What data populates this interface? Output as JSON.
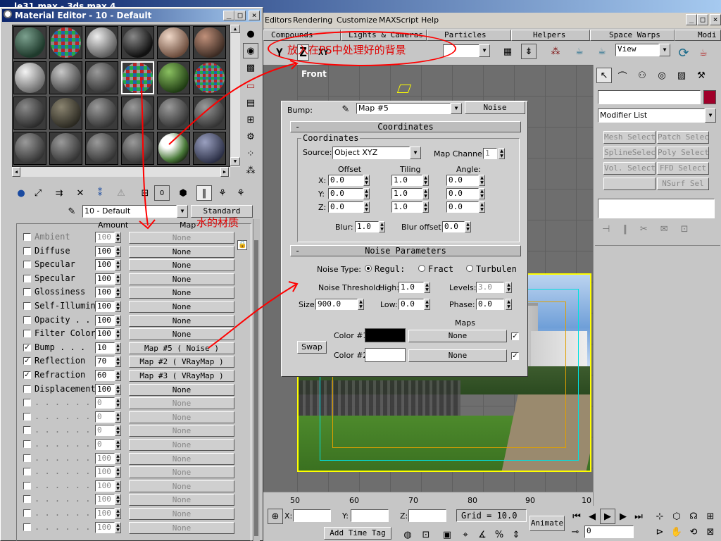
{
  "window_title": "le31.max - 3ds max 4",
  "menu": {
    "items": [
      "Editors",
      "Rendering",
      "Customize",
      "MAXScript",
      "Help"
    ],
    "window_buttons": [
      "_",
      "□",
      "×"
    ]
  },
  "command_tabs": [
    "Compounds",
    "Lights & Cameras",
    "Particles",
    "Helpers",
    "Space Warps",
    "Modi"
  ],
  "toolbar": {
    "view_dropdown": "View",
    "axis_letters": [
      "Y",
      "Z",
      "XY"
    ]
  },
  "annotation_top": "放入在PS中处理好的背景",
  "annotation_water": "水的材质",
  "viewport": {
    "label": "Front"
  },
  "timeline": {
    "ticks": [
      "50",
      "60",
      "70",
      "80",
      "90",
      "10"
    ]
  },
  "status": {
    "x_label": "X:",
    "y_label": "Y:",
    "z_label": "Z:",
    "grid": "Grid = 10.0",
    "animate": "Animate",
    "add_time_tag": "Add Time Tag",
    "frame": "0"
  },
  "command_panel": {
    "modifier_list": "Modifier List",
    "buttons": [
      "Mesh Select",
      "Patch Select",
      "SplineSelect",
      "Poly Select",
      "Vol. Select",
      "FFD Select",
      "",
      "NSurf Sel"
    ],
    "swatch_color": "#a0002a"
  },
  "material_editor": {
    "title": "Material Editor - 10 - Default",
    "material_name": "10 - Default",
    "type_button": "Standard",
    "col_amount": "Amount",
    "col_map": "Map",
    "rows": [
      {
        "label": "Ambient",
        "checked": false,
        "amount": "100",
        "map": "None",
        "dim": true
      },
      {
        "label": "Diffuse",
        "checked": false,
        "amount": "100",
        "map": "None",
        "dim": false
      },
      {
        "label": "Specular",
        "checked": false,
        "amount": "100",
        "map": "None",
        "dim": false
      },
      {
        "label": "Specular",
        "checked": false,
        "amount": "100",
        "map": "None",
        "dim": false
      },
      {
        "label": "Glossiness",
        "checked": false,
        "amount": "100",
        "map": "None",
        "dim": false
      },
      {
        "label": "Self-Illumin",
        "checked": false,
        "amount": "100",
        "map": "None",
        "dim": false
      },
      {
        "label": "Opacity . .",
        "checked": false,
        "amount": "100",
        "map": "None",
        "dim": false
      },
      {
        "label": "Filter Color",
        "checked": false,
        "amount": "100",
        "map": "None",
        "dim": false
      },
      {
        "label": "Bump  . . .",
        "checked": true,
        "amount": "10",
        "map": "Map #5  ( Noise )",
        "dim": false
      },
      {
        "label": "Reflection",
        "checked": true,
        "amount": "70",
        "map": "Map #2  ( VRayMap )",
        "dim": false
      },
      {
        "label": "Refraction",
        "checked": true,
        "amount": "60",
        "map": "Map #3  ( VRayMap )",
        "dim": false
      },
      {
        "label": "Displacement",
        "checked": false,
        "amount": "100",
        "map": "None",
        "dim": false
      },
      {
        "label": ". . . . . . .",
        "checked": false,
        "amount": "0",
        "map": "None",
        "dim": true
      },
      {
        "label": ". . . . . . .",
        "checked": false,
        "amount": "0",
        "map": "None",
        "dim": true
      },
      {
        "label": ". . . . . . .",
        "checked": false,
        "amount": "0",
        "map": "None",
        "dim": true
      },
      {
        "label": ". . . . . . .",
        "checked": false,
        "amount": "0",
        "map": "None",
        "dim": true
      },
      {
        "label": ". . . . . . .",
        "checked": false,
        "amount": "100",
        "map": "None",
        "dim": true
      },
      {
        "label": ". . . . . . .",
        "checked": false,
        "amount": "100",
        "map": "None",
        "dim": true
      },
      {
        "label": ". . . . . . .",
        "checked": false,
        "amount": "100",
        "map": "None",
        "dim": true
      },
      {
        "label": ". . . . . . .",
        "checked": false,
        "amount": "100",
        "map": "None",
        "dim": true
      },
      {
        "label": ". . . . . . .",
        "checked": false,
        "amount": "100",
        "map": "None",
        "dim": true
      },
      {
        "label": ". . . . . . .",
        "checked": false,
        "amount": "100",
        "map": "None",
        "dim": true
      }
    ]
  },
  "noise_panel": {
    "bump_label": "Bump:",
    "map_name": "Map #5",
    "map_type": "Noise",
    "coords_rollout": "Coordinates",
    "coords_group": "Coordinates",
    "source_label": "Source:",
    "source_value": "Object XYZ",
    "map_channel_label": "Map Channel:",
    "map_channel_value": "1",
    "col_offset": "Offset",
    "col_tiling": "Tiling",
    "col_angle": "Angle:",
    "axes": [
      {
        "axis": "X:",
        "offset": "0.0",
        "tiling": "1.0",
        "angle": "0.0"
      },
      {
        "axis": "Y:",
        "offset": "0.0",
        "tiling": "1.0",
        "angle": "0.0"
      },
      {
        "axis": "Z:",
        "offset": "0.0",
        "tiling": "1.0",
        "angle": "0.0"
      }
    ],
    "blur_label": "Blur:",
    "blur_value": "1.0",
    "blur_offset_label": "Blur offset:",
    "blur_offset_value": "0.0",
    "noise_rollout": "Noise Parameters",
    "noise_type_label": "Noise Type:",
    "noise_types": [
      "Regul:",
      "Fract",
      "Turbulen"
    ],
    "threshold_label": "Noise Threshold:",
    "high_label": "High:",
    "high_value": "1.0",
    "levels_label": "Levels:",
    "levels_value": "3.0",
    "size_label": "Size:",
    "size_value": "900.0",
    "low_label": "Low:",
    "low_value": "0.0",
    "phase_label": "Phase:",
    "phase_value": "0.0",
    "maps_label": "Maps",
    "swap_label": "Swap",
    "color1_label": "Color #1",
    "color1_map": "None",
    "color1": "#000000",
    "color2_label": "Color #2",
    "color2_map": "None",
    "color2": "#ffffff"
  }
}
